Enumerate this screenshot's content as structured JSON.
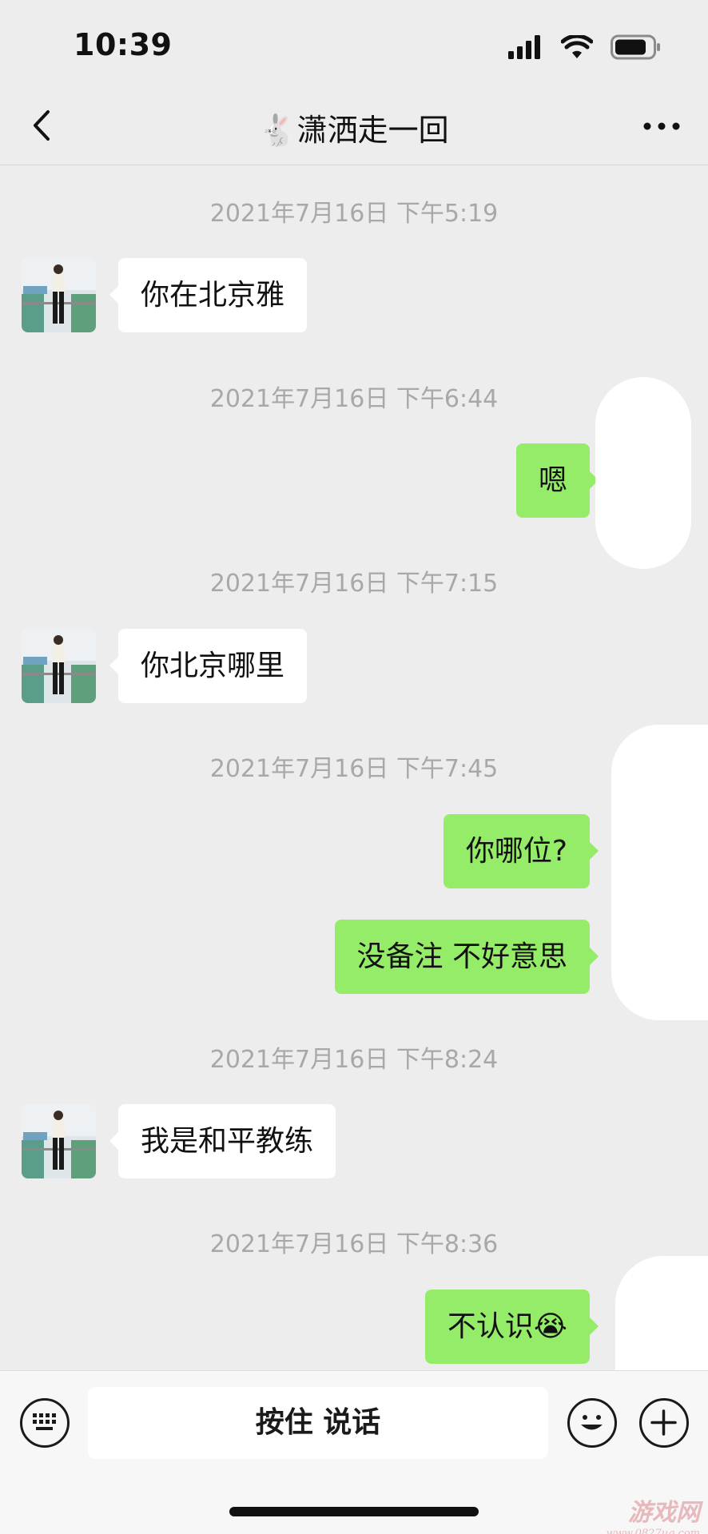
{
  "status_bar": {
    "time": "10:39",
    "icons": [
      "cellular-signal-icon",
      "wifi-icon",
      "battery-icon"
    ]
  },
  "nav": {
    "title": "🐇潇洒走一回",
    "back_icon": "chevron-left-icon",
    "more_icon": "more-dots-icon"
  },
  "colors": {
    "background": "#ededed",
    "incoming_bubble": "#ffffff",
    "outgoing_bubble": "#95ec69",
    "timestamp_text": "#a8a8a8"
  },
  "messages": [
    {
      "timestamp": "2021年7月16日 下午5:19",
      "direction": "in",
      "text": "你在北京雅"
    },
    {
      "timestamp": "2021年7月16日 下午6:44",
      "direction": "out",
      "text": "嗯"
    },
    {
      "timestamp": "2021年7月16日 下午7:15",
      "direction": "in",
      "text": "你北京哪里"
    },
    {
      "timestamp": "2021年7月16日 下午7:45",
      "direction": "out",
      "text": "你哪位?"
    },
    {
      "direction": "out",
      "text": "没备注 不好意思"
    },
    {
      "timestamp": "2021年7月16日 下午8:24",
      "direction": "in",
      "text": "我是和平教练"
    },
    {
      "timestamp": "2021年7月16日 下午8:36",
      "direction": "out",
      "text": "不认识😭"
    }
  ],
  "input_bar": {
    "keyboard_icon": "keyboard-icon",
    "voice_label": "按住 说话",
    "emoji_icon": "emoji-smile-icon",
    "add_icon": "plus-icon"
  },
  "watermark": {
    "name": "游戏网",
    "url": "www.0827ug.com"
  }
}
